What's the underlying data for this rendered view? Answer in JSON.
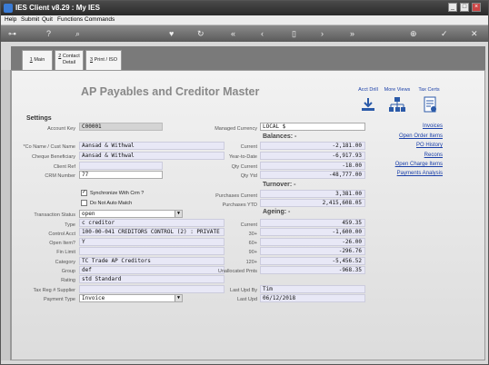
{
  "window": {
    "title": "IES Client v8.29 : My IES"
  },
  "menu": [
    "Help",
    "Submit",
    "Quit",
    "Functions",
    "Commands"
  ],
  "tabs": [
    {
      "num": "1",
      "label": "Main"
    },
    {
      "num": "2",
      "label": "Contact Detail"
    },
    {
      "num": "3",
      "label": "Print / ISO"
    }
  ],
  "page": {
    "title": "AP Payables and Creditor Master",
    "settings_heading": "Settings"
  },
  "top_icons": [
    "Acct Drill",
    "More Views",
    "Tax Certs"
  ],
  "left": {
    "account_key": {
      "label": "Account Key",
      "value": "C00001"
    },
    "co_name": {
      "label": "*Co Name / Cust Name",
      "value": "Aansad & Withwal"
    },
    "cheque_beneficiary": {
      "label": "Cheque Beneficiary",
      "value": "Aansad & Withwal"
    },
    "client_ref": {
      "label": "Client Ref",
      "value": ""
    },
    "crm_number": {
      "label": "CRM Number",
      "value": "77"
    },
    "sync_crm": {
      "label": "Synchronize With Crm ?",
      "checked": "✓"
    },
    "no_auto_match": {
      "label": "Do Not Auto Match",
      "checked": ""
    },
    "transaction_status": {
      "label": "Transaction Status",
      "value": "open"
    },
    "type": {
      "label": "Type",
      "value": "c creditor"
    },
    "control_acct": {
      "label": "Control Acct",
      "value": "100-00-041 CREDITORS CONTROL (2) : PRIVATE"
    },
    "open_item": {
      "label": "Open Item?",
      "value": "Y"
    },
    "fin_limit": {
      "label": "Fin Limit",
      "value": ""
    },
    "category": {
      "label": "Category",
      "value": "TC Trade AP Creditors"
    },
    "group": {
      "label": "Group",
      "value": "def"
    },
    "rating": {
      "label": "Rating",
      "value": "std Standard"
    },
    "tax_reg": {
      "label": "Tax Reg # Supplier",
      "value": ""
    },
    "payment_type": {
      "label": "Payment Type",
      "value": "Invoice"
    }
  },
  "right": {
    "managed_currency": {
      "label": "Managed Currency",
      "value": "LOCAL $"
    },
    "balances_heading": "Balances: -",
    "current": {
      "label": "Current",
      "value": "-2,181.00"
    },
    "year_to_date": {
      "label": "Year-to-Date",
      "value": "-6,917.93"
    },
    "qty_current": {
      "label": "Qty Current",
      "value": "-18.00"
    },
    "qty_ytd": {
      "label": "Qty Ytd",
      "value": "-48,777.00"
    },
    "turnover_heading": "Turnover: -",
    "purchases_current": {
      "label": "Purchases Current",
      "value": "3,381.00"
    },
    "purchases_ytd": {
      "label": "Purchases YTD",
      "value": "2,415,608.05"
    },
    "ageing_heading": "Ageing: -",
    "age_current": {
      "label": "Current",
      "value": "459.35"
    },
    "age_30": {
      "label": "30+",
      "value": "-1,600.00"
    },
    "age_60": {
      "label": "60+",
      "value": "-26.00"
    },
    "age_90": {
      "label": "90+",
      "value": "-296.76"
    },
    "age_120": {
      "label": "120+",
      "value": "-5,456.52"
    },
    "unallocated": {
      "label": "Unallocated Pmts",
      "value": "-968.35"
    },
    "last_upd_by": {
      "label": "Last Upd By",
      "value": "Tim"
    },
    "last_upd": {
      "label": "Last Upd",
      "value": "06/12/2018"
    }
  },
  "links": [
    "Invoices",
    "Open Order Items",
    "PO History",
    "Recons",
    "Open Charge Items",
    "Payments Analysis"
  ]
}
